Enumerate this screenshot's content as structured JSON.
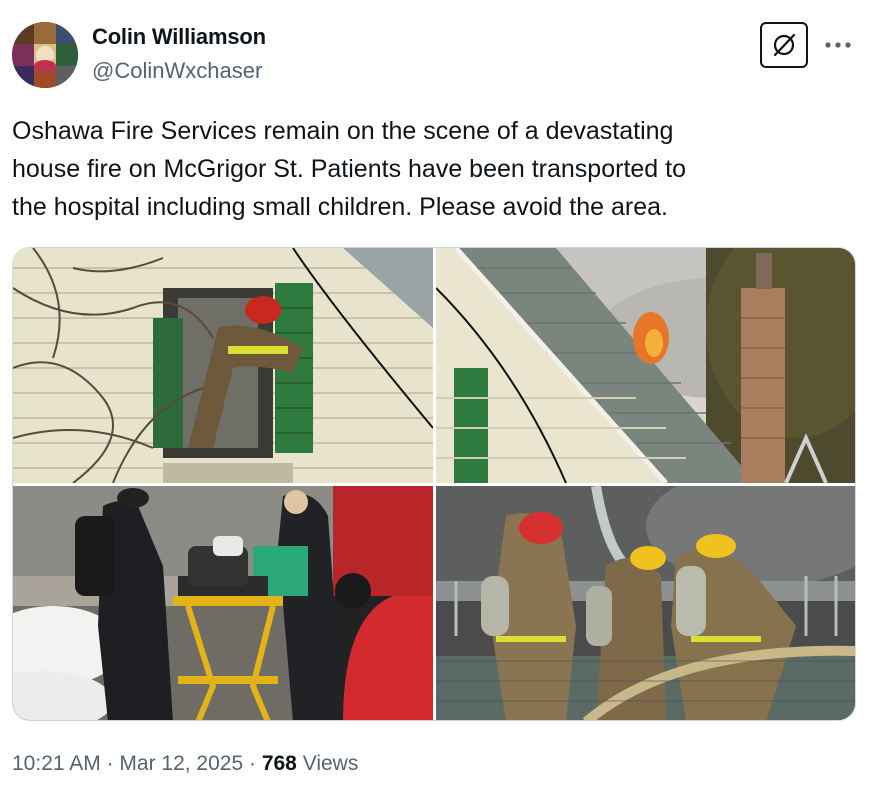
{
  "author": {
    "name": "Colin Williamson",
    "handle": "@ColinWxchaser"
  },
  "actions": {
    "grok_icon": "grok-icon",
    "more_icon": "more-horizontal-icon"
  },
  "tweet": {
    "text": "Oshawa Fire Services remain on the scene of a devastating\nhouse fire on McGrigor St.  Patients have been transported to\nthe hospital including small children.  Please avoid the area."
  },
  "media": {
    "count": 4,
    "photos": [
      {
        "subject": "firefighter-at-window-photo"
      },
      {
        "subject": "smoking-roof-photo"
      },
      {
        "subject": "paramedics-stretcher-photo"
      },
      {
        "subject": "firefighters-hose-photo"
      }
    ]
  },
  "meta": {
    "time": "10:21 AM",
    "separator1": " · ",
    "date": "Mar 12, 2025",
    "separator2": " · ",
    "views_count": "768",
    "views_label": " Views"
  },
  "colors": {
    "text_primary": "#0f1419",
    "text_secondary": "#536471",
    "border": "#cfd9de"
  }
}
